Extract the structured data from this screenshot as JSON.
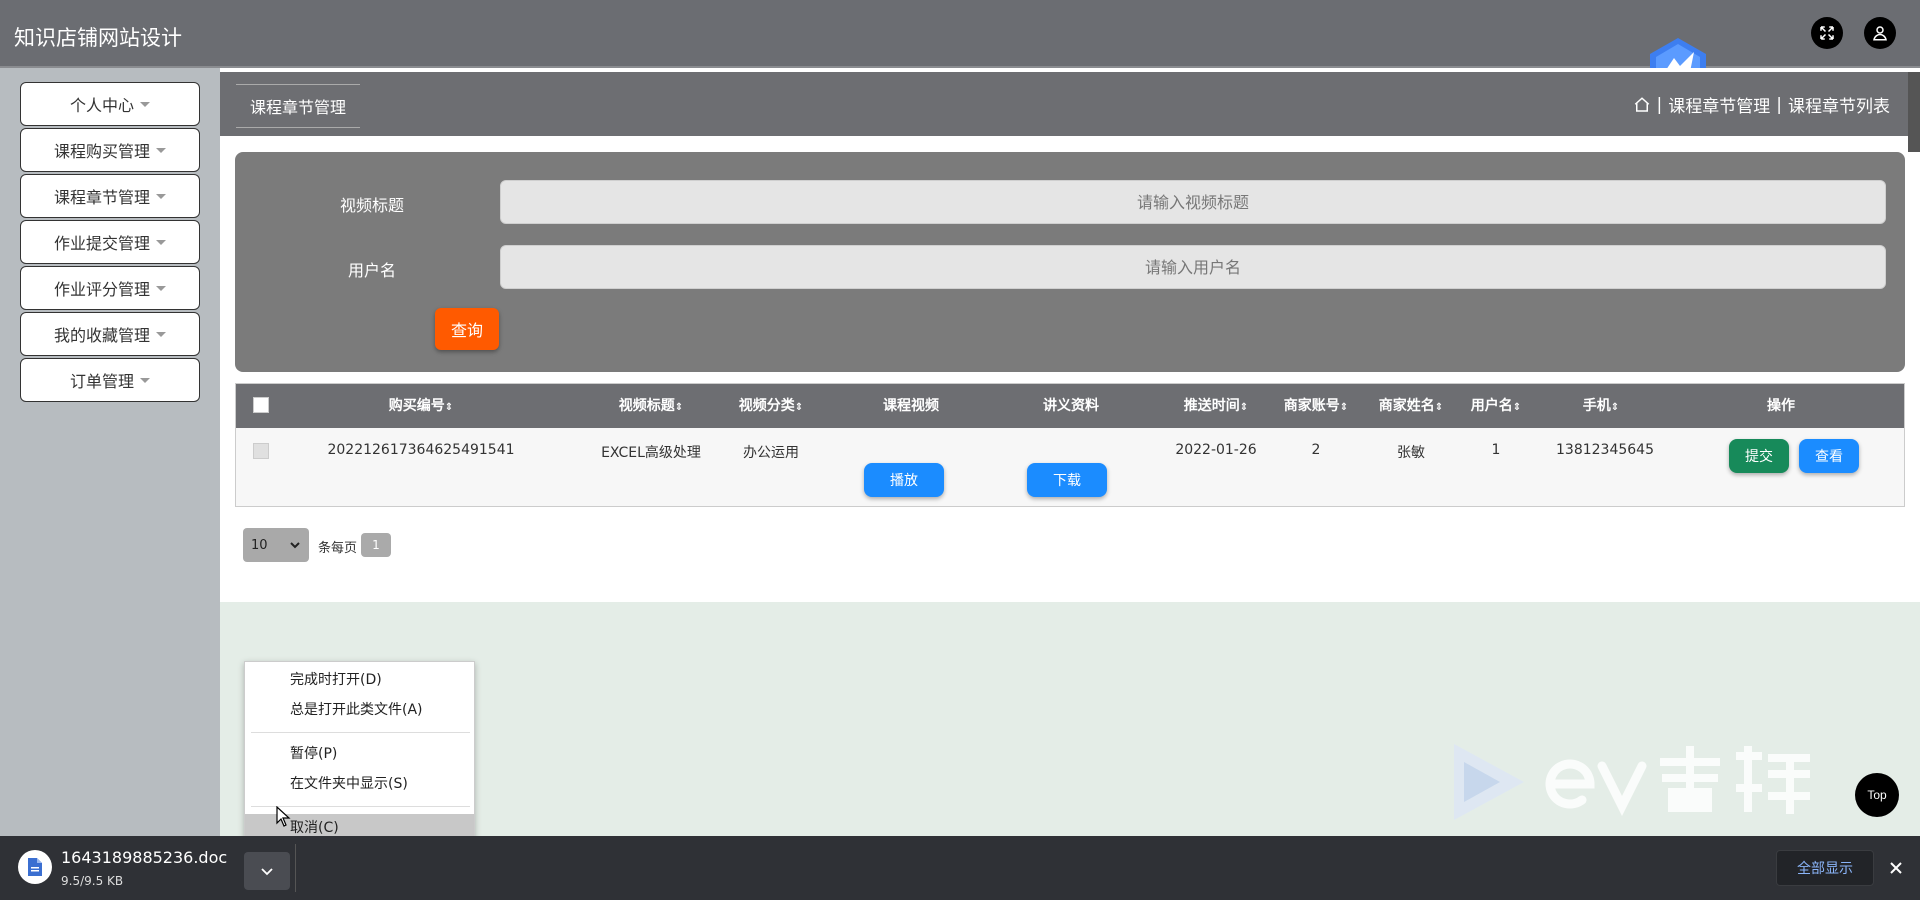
{
  "app": {
    "title": "知识店铺网站设计"
  },
  "sidebar": {
    "items": [
      {
        "label": "个人中心"
      },
      {
        "label": "课程购买管理"
      },
      {
        "label": "课程章节管理"
      },
      {
        "label": "作业提交管理"
      },
      {
        "label": "作业评分管理"
      },
      {
        "label": "我的收藏管理"
      },
      {
        "label": "订单管理"
      }
    ]
  },
  "breadcrumb": {
    "tab": "课程章节管理",
    "separator": "|",
    "path1": "课程章节管理",
    "path2": "课程章节列表"
  },
  "search": {
    "title_label": "视频标题",
    "title_placeholder": "请输入视频标题",
    "user_label": "用户名",
    "user_placeholder": "请输入用户名",
    "query_button": "查询"
  },
  "table": {
    "columns": [
      "购买编号",
      "视频标题",
      "视频分类",
      "课程视频",
      "讲义资料",
      "推送时间",
      "商家账号",
      "商家姓名",
      "用户名",
      "手机",
      "操作"
    ],
    "rows": [
      {
        "order_no": "202212617364625491541",
        "video_title": "EXCEL高级处理",
        "category": "办公运用",
        "play_button": "播放",
        "download_button": "下载",
        "push_time": "2022-01-26",
        "merchant_account": "2",
        "merchant_name": "张敏",
        "username": "1",
        "phone": "13812345645",
        "submit_button": "提交",
        "view_button": "查看"
      }
    ]
  },
  "pagination": {
    "page_size": "10",
    "per_page_label": "条每页",
    "current_page": "1"
  },
  "context_menu": {
    "items": [
      "完成时打开(D)",
      "总是打开此类文件(A)",
      "暂停(P)",
      "在文件夹中显示(S)",
      "取消(C)"
    ]
  },
  "download_bar": {
    "file_name": "1643189885236.doc",
    "file_size": "9.5/9.5 KB",
    "show_all": "全部显示"
  },
  "top_button": "Top",
  "colors": {
    "header": "#6b6d72",
    "query": "#ff5a00",
    "primary_blue": "#1b8cff",
    "submit_green": "#178a5a"
  }
}
